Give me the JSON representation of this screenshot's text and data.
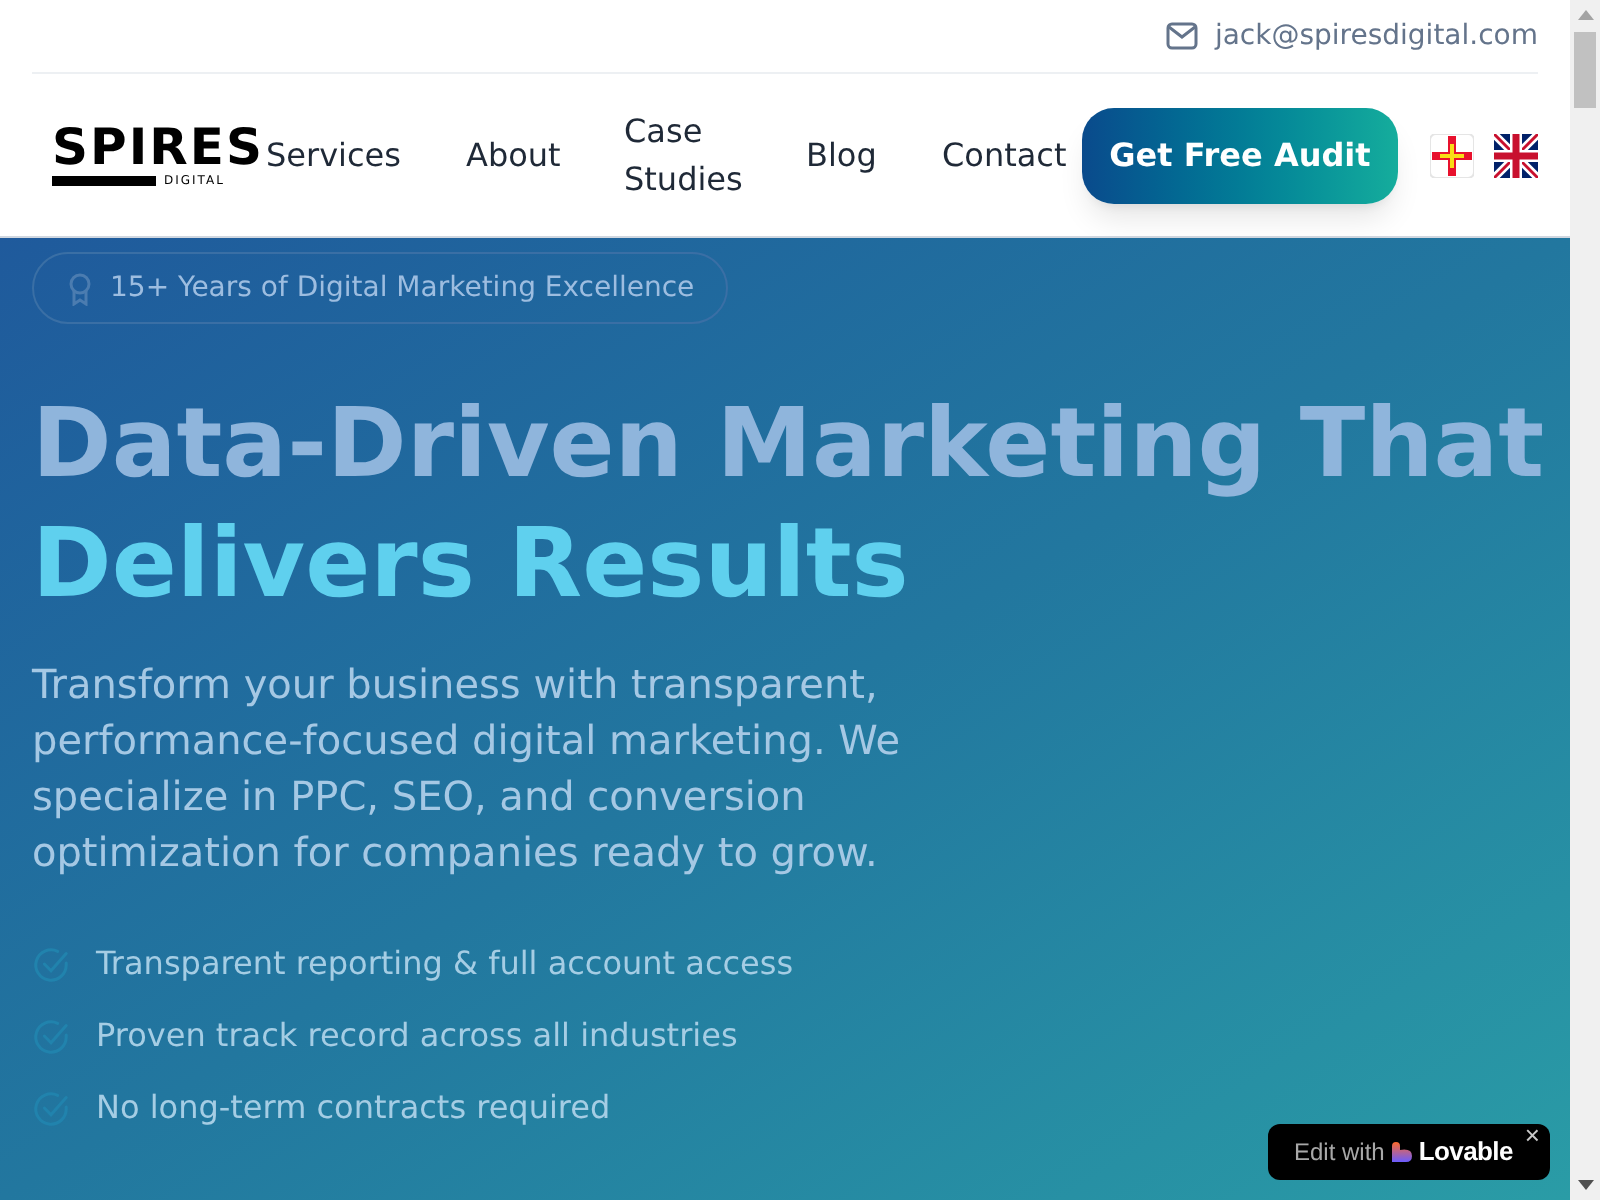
{
  "header": {
    "email": "jack@spiresdigital.com",
    "logo": {
      "name": "SPIRES",
      "tagline": "DIGITAL"
    },
    "nav": [
      "Services",
      "About",
      "Case Studies",
      "Blog",
      "Contact"
    ],
    "cta": "Get Free Audit",
    "languages": [
      {
        "kind": "guernsey"
      },
      {
        "kind": "uk"
      }
    ]
  },
  "hero": {
    "badge": "15+ Years of Digital Marketing Excellence",
    "title_line_1": "Data-Driven Marketing That",
    "title_line_2": "Delivers Results",
    "description": "Transform your business with transparent, performance-focused digital marketing. We specialize in PPC, SEO, and conversion optimization for companies ready to grow.",
    "features": [
      "Transparent reporting & full account access",
      "Proven track record across all industries",
      "No long-term contracts required"
    ]
  },
  "edit_badge": {
    "label": "Edit with",
    "brand": "Lovable",
    "close": "×"
  }
}
